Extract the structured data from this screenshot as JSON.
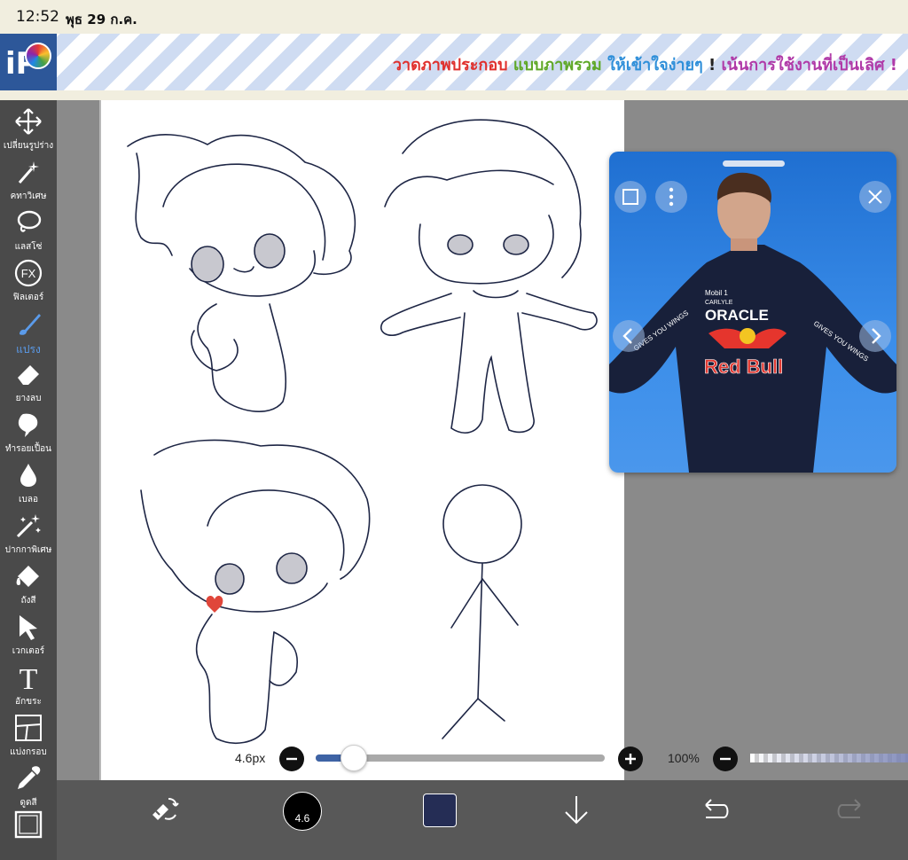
{
  "status_bar": {
    "time": "12:52",
    "date": "พุธ 29 ก.ค."
  },
  "banner": {
    "logo_text": "iP",
    "text_parts": [
      "วาดภาพประกอบ",
      "แบบภาพรวม",
      "ให้เข้าใจง่ายๆ",
      "!",
      "เน้นการใช้งานที่เป็นเลิศ !"
    ]
  },
  "toolbar": {
    "items": [
      {
        "label": "เปลี่ยนรูปร่าง",
        "icon": "move-icon"
      },
      {
        "label": "คทาวิเศษ",
        "icon": "magic-wand-icon"
      },
      {
        "label": "แลสโซ่",
        "icon": "lasso-icon"
      },
      {
        "label": "ฟิลเตอร์",
        "icon": "fx-icon",
        "icon_text": "FX"
      },
      {
        "label": "แปรง",
        "icon": "brush-icon",
        "active": true
      },
      {
        "label": "ยางลบ",
        "icon": "eraser-icon"
      },
      {
        "label": "ทำรอยเปื้อน",
        "icon": "smudge-icon"
      },
      {
        "label": "เบลอ",
        "icon": "blur-drop-icon"
      },
      {
        "label": "ปากกาพิเศษ",
        "icon": "special-pen-icon"
      },
      {
        "label": "ถังสี",
        "icon": "bucket-icon"
      },
      {
        "label": "เวกเตอร์",
        "icon": "vector-arrow-icon"
      },
      {
        "label": "อักขระ",
        "icon": "text-icon",
        "icon_text": "T"
      },
      {
        "label": "แบ่งกรอบ",
        "icon": "frame-divider-icon"
      },
      {
        "label": "ดูดสี",
        "icon": "eyedropper-icon"
      },
      {
        "label": "",
        "icon": "canvas-icon"
      }
    ]
  },
  "brush": {
    "size_label": "4.6px",
    "size_value": 4.6,
    "size_fraction": 0.13,
    "opacity_label": "100%"
  },
  "bottom_bar": {
    "brush_size_text": "4.6",
    "current_color": "#252d55"
  },
  "reference_window": {
    "subject": "racing driver in Red Bull suit",
    "sponsor_texts": [
      "ORACLE",
      "Red Bull",
      "Mobil 1",
      "CARLYLE",
      "GIVES YOU WINGS"
    ]
  }
}
